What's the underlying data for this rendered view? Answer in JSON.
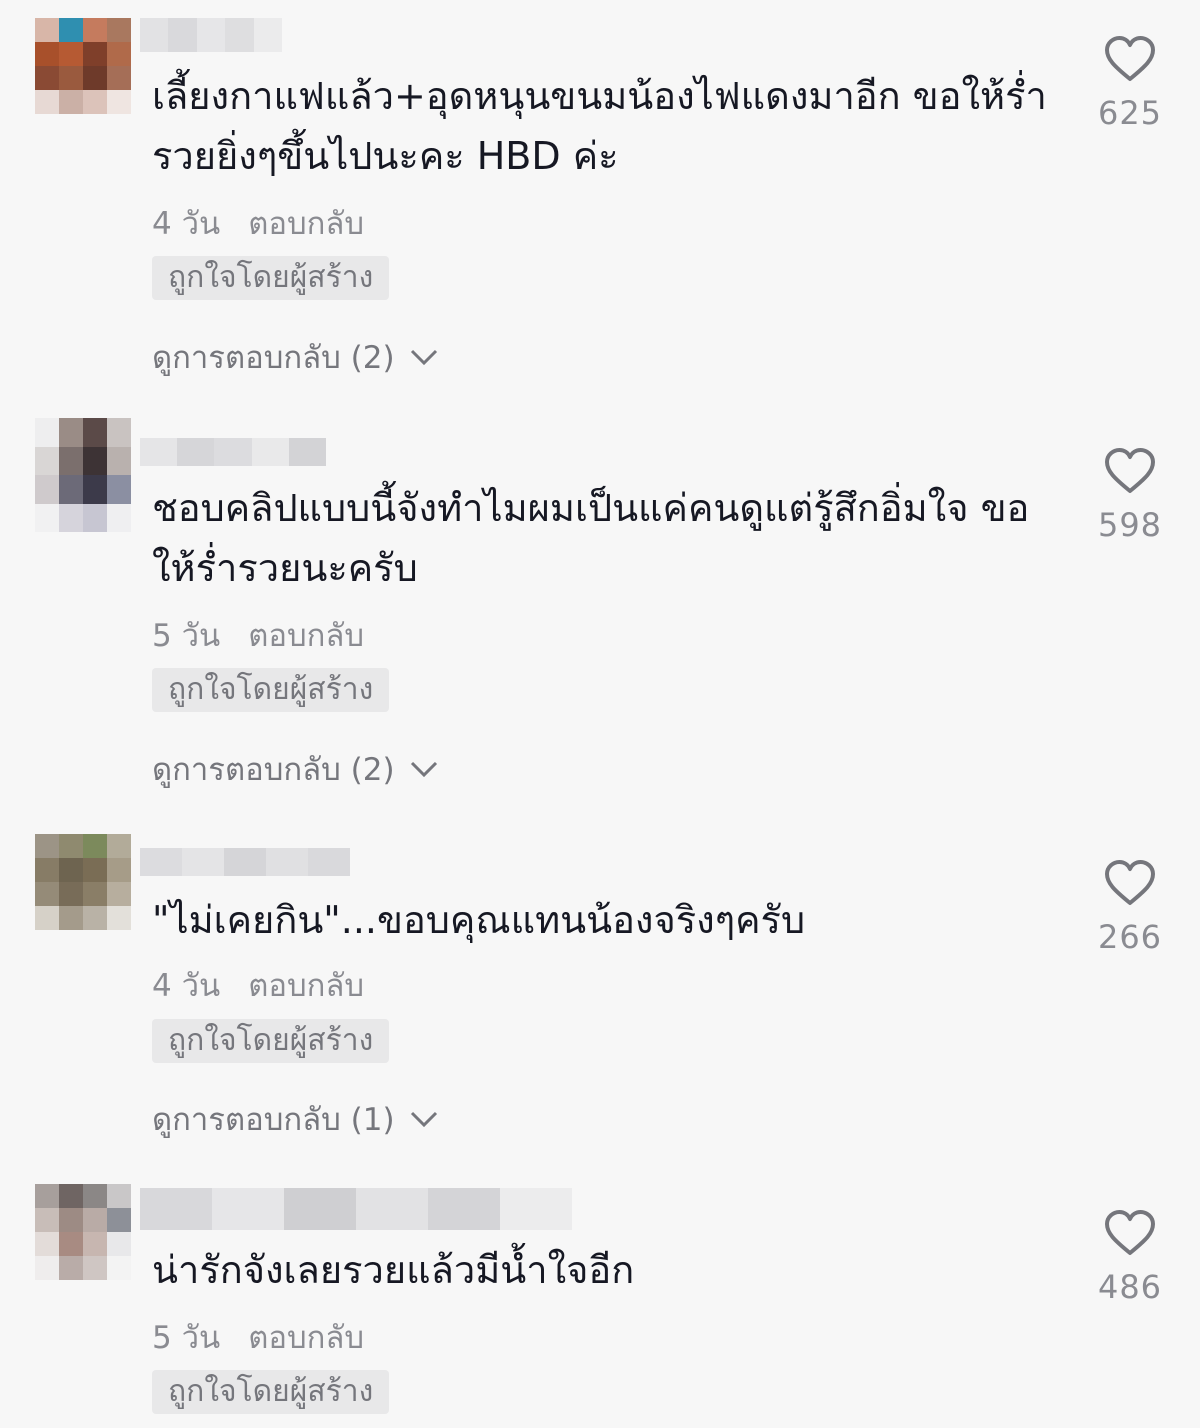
{
  "comments": [
    {
      "text": "เลี้ยงกาแฟแล้ว+อุดหนุนขนมน้องไฟแดงมาอีก ขอให้ร่ำรวยยิ่งๆขึ้นไปนะคะ HBD ค่ะ",
      "time": "4 วัน",
      "reply_label": "ตอบกลับ",
      "badge": "ถูกใจโดยผู้สร้าง",
      "view_replies": "ดูการตอบกลับ (2)",
      "likes": "625",
      "avatar_colors": [
        "#d8b6a8",
        "#2f8fb0",
        "#c57b5e",
        "#a9785f",
        "#a8502b",
        "#b65a33",
        "#7f3f2a",
        "#b06a4a",
        "#8a4a34",
        "#9a5a3e",
        "#6e3a2a",
        "#a56e57",
        "#e7d9d4",
        "#cbb0a6",
        "#dcc3ba",
        "#efe5e1"
      ],
      "username_colors": [
        "#e2e2e4",
        "#d9d9dc",
        "#e6e6e8",
        "#dedee0",
        "#ebebec"
      ]
    },
    {
      "text": "ชอบคลิปแบบนี้จังทำไมผมเป็นแค่คนดูแต่รู้สึกอิ่มใจ ขอให้ร่ำรวยนะครับ",
      "time": "5 วัน",
      "reply_label": "ตอบกลับ",
      "badge": "ถูกใจโดยผู้สร้าง",
      "view_replies": "ดูการตอบกลับ (2)",
      "likes": "598",
      "avatar_colors": [
        "#eeeeef",
        "#9a8c86",
        "#5b4a48",
        "#c9c3c1",
        "#d9d6d5",
        "#7b6f6d",
        "#3d3335",
        "#b9b1ae",
        "#cfcacc",
        "#6c6a78",
        "#3c3a4a",
        "#8b8fa2",
        "#f1f1f2",
        "#d6d4dc",
        "#c7c6d2",
        "#efeff1"
      ],
      "username_colors": [
        "#e5e5e7",
        "#d6d6d9",
        "#dcdcdf",
        "#e9e9ea",
        "#d3d3d6"
      ]
    },
    {
      "text": "\"ไม่เคยกิน\"...ขอบคุณแทนน้องจริงๆครับ",
      "time": "4 วัน",
      "reply_label": "ตอบกลับ",
      "badge": "ถูกใจโดยผู้สร้าง",
      "view_replies": "ดูการตอบกลับ (1)",
      "likes": "266",
      "avatar_colors": [
        "#9c9486",
        "#8f8a6f",
        "#7c8a5c",
        "#b2ab99",
        "#877c66",
        "#6e6450",
        "#7a6d55",
        "#a69c88",
        "#958b78",
        "#786c58",
        "#8a7e67",
        "#b7ae9e",
        "#d6d1c8",
        "#a49b8b",
        "#b9b2a6",
        "#e3e0da"
      ],
      "username_colors": [
        "#dcdcdf",
        "#e4e4e6",
        "#d5d5d8",
        "#e0e0e2",
        "#d9d9dc"
      ]
    },
    {
      "text": "น่ารักจังเลยรวยแล้วมีน้ำใจอีก",
      "time": "5 วัน",
      "reply_label": "ตอบกลับ",
      "badge": "ถูกใจโดยผู้สร้าง",
      "likes": "486",
      "avatar_colors": [
        "#a79f9c",
        "#6f6563",
        "#8b8786",
        "#c9c7c8",
        "#c8bdb8",
        "#9d8b84",
        "#b9aba6",
        "#8d9098",
        "#e3dcd9",
        "#a88b82",
        "#c7b6b0",
        "#e8e8ea",
        "#efeded",
        "#b9aca8",
        "#cfc6c3",
        "#f3f3f3"
      ],
      "username_colors": [
        "#d8d8db",
        "#e6e6e8",
        "#cfcfd2",
        "#e2e2e4",
        "#d4d4d7",
        "#ececed"
      ]
    }
  ]
}
